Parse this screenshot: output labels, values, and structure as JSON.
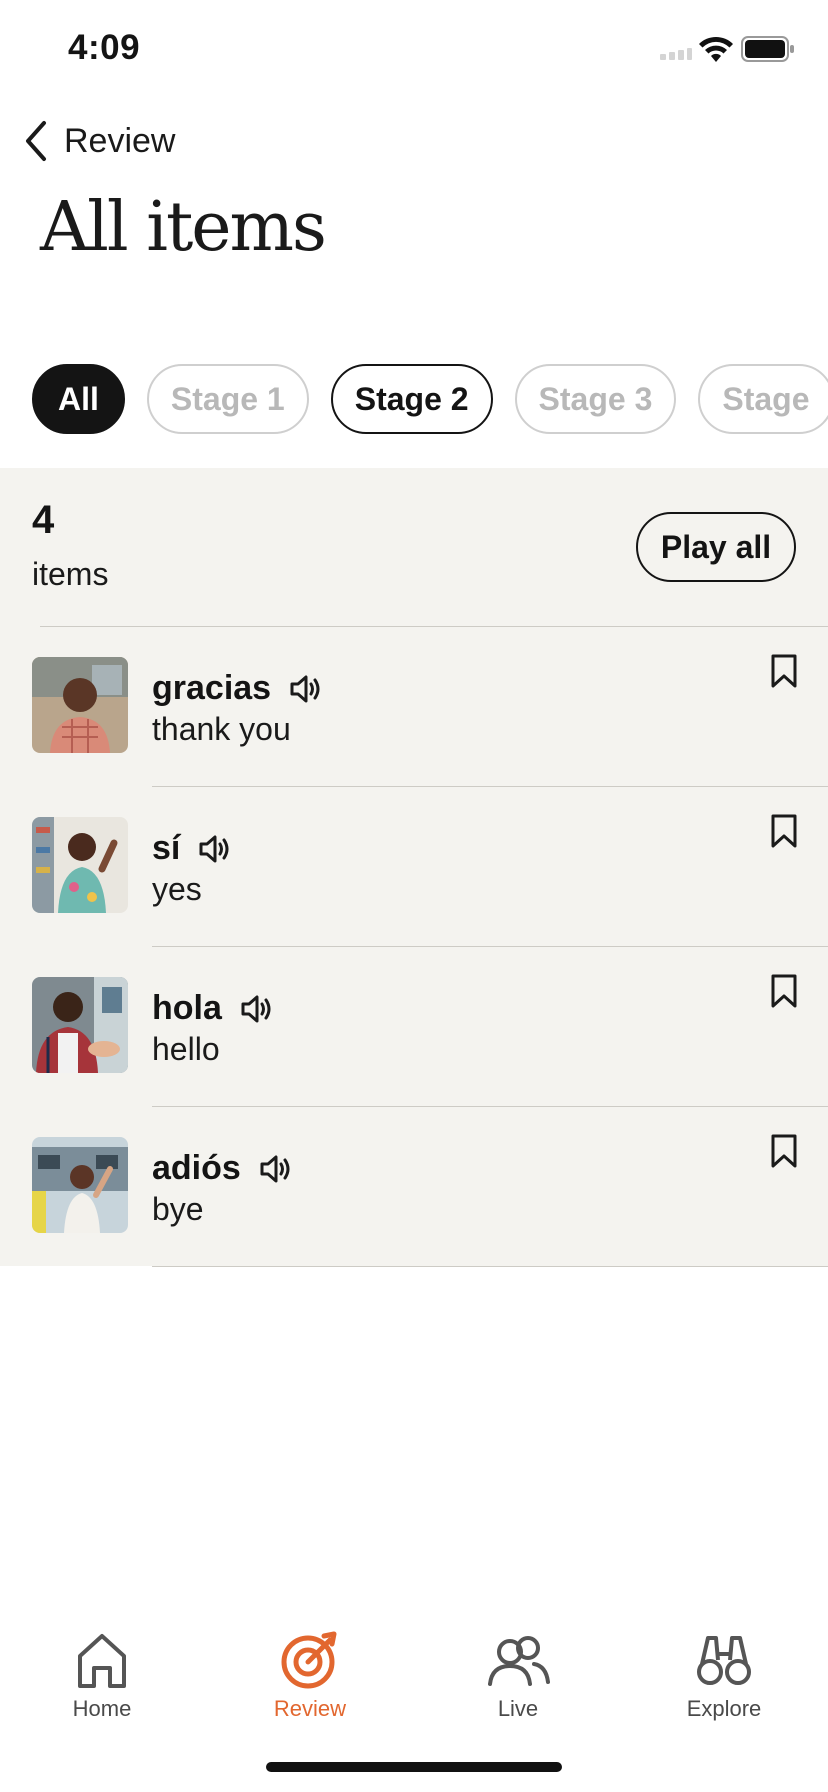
{
  "status_bar": {
    "time": "4:09"
  },
  "nav": {
    "back_label": "Review"
  },
  "page": {
    "title": "All items"
  },
  "chips": [
    {
      "label": "All",
      "state": "selected"
    },
    {
      "label": "Stage 1",
      "state": "default"
    },
    {
      "label": "Stage 2",
      "state": "outlined"
    },
    {
      "label": "Stage 3",
      "state": "default"
    },
    {
      "label": "Stage",
      "state": "default"
    }
  ],
  "summary": {
    "count": "4",
    "count_label": "items",
    "play_all": "Play all"
  },
  "items": [
    {
      "word": "gracias",
      "translation": "thank you",
      "image": "older-man-smiling"
    },
    {
      "word": "sí",
      "translation": "yes",
      "image": "woman-celebrating-with-phone"
    },
    {
      "word": "hola",
      "translation": "hello",
      "image": "man-handshake-at-train"
    },
    {
      "word": "adiós",
      "translation": "bye",
      "image": "woman-waving-at-train"
    }
  ],
  "tabs": [
    {
      "label": "Home",
      "icon": "home-icon",
      "active": false
    },
    {
      "label": "Review",
      "icon": "target-icon",
      "active": true
    },
    {
      "label": "Live",
      "icon": "people-icon",
      "active": false
    },
    {
      "label": "Explore",
      "icon": "binoculars-icon",
      "active": false
    }
  ],
  "colors": {
    "accent": "#e2672f",
    "panel_bg": "#f4f3ef",
    "ink": "#141414"
  }
}
